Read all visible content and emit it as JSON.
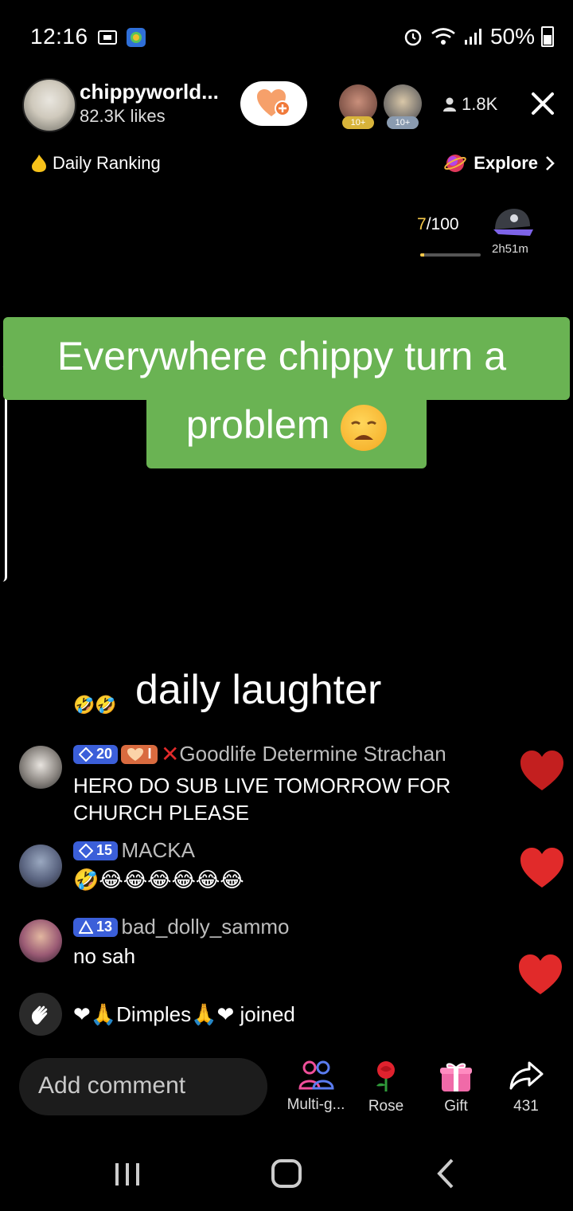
{
  "status_bar": {
    "time": "12:16",
    "battery": "50%"
  },
  "header": {
    "host_name": "chippyworld...",
    "host_likes": "82.3K likes",
    "viewer_count": "1.8K",
    "viewer_badges": [
      "10+",
      "10+"
    ]
  },
  "ranking": {
    "daily_ranking": "Daily Ranking",
    "explore": "Explore"
  },
  "goal": {
    "current": "7",
    "total": "/100",
    "progress": 0.07,
    "timer": "2h51m"
  },
  "caption": {
    "line1": "Everywhere chippy turn a",
    "line2": "problem"
  },
  "chat": {
    "overlay_text": "daily laughter",
    "messages": [
      {
        "level": "20",
        "fan_badge": "I",
        "username": "Goodlife Determine Strachan",
        "text": "HERO DO SUB LIVE TOMORROW FOR CHURCH PLEASE"
      },
      {
        "level": "15",
        "username": "MACKA",
        "text": "🤣😂😂😂😂😂😂"
      },
      {
        "level": "13",
        "username": "bad_dolly_sammo",
        "text": "no sah"
      }
    ],
    "join": {
      "username": "❤🙏Dimples🙏❤",
      "action": "joined"
    }
  },
  "bottom": {
    "comment_placeholder": "Add comment",
    "actions": {
      "multi_guest": "Multi-g...",
      "rose": "Rose",
      "gift": "Gift",
      "share_count": "431"
    }
  },
  "colors": {
    "caption_bg": "#6ab353",
    "heart": "#e12a2a",
    "level_badge": "#3b5fd9"
  }
}
